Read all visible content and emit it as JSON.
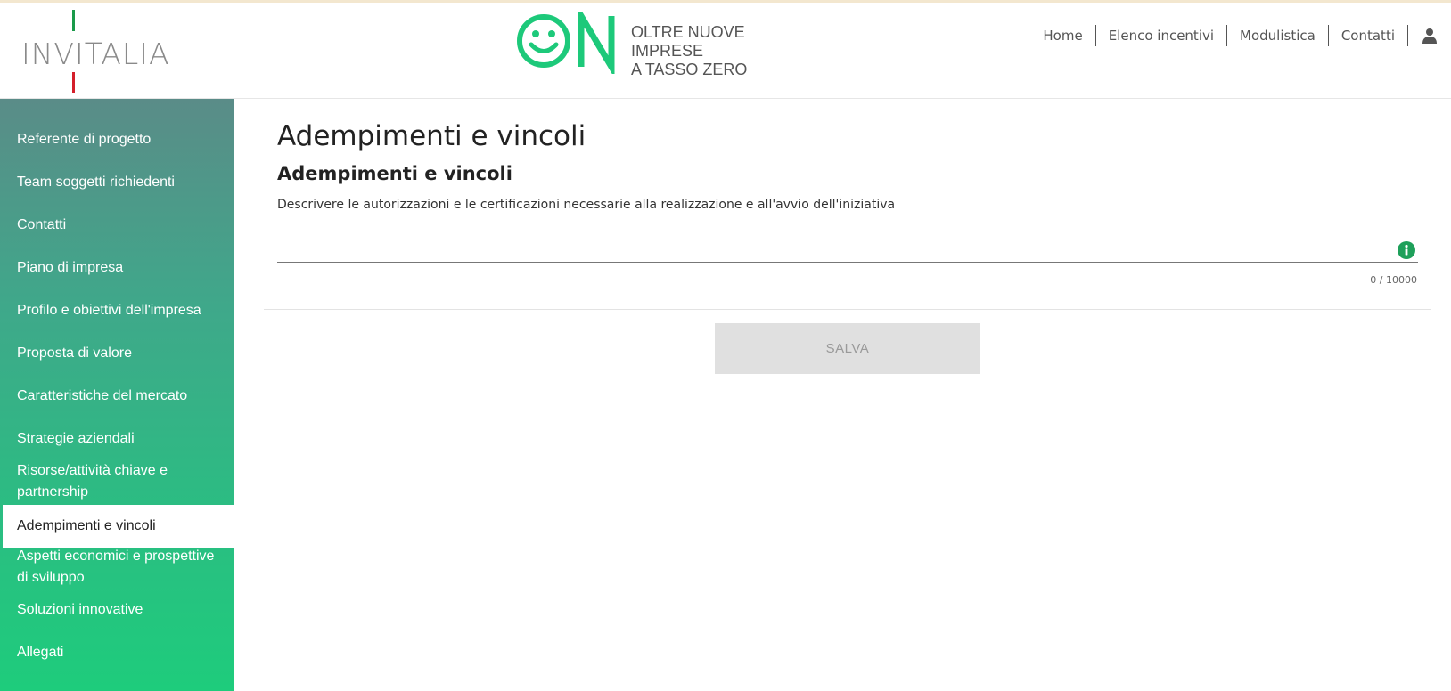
{
  "header": {
    "brand": "INVITALIA",
    "on_logo_tagline_1": "OLTRE NUOVE IMPRESE",
    "on_logo_tagline_2": "A TASSO ZERO",
    "nav": [
      {
        "label": "Home"
      },
      {
        "label": "Elenco incentivi"
      },
      {
        "label": "Modulistica"
      },
      {
        "label": "Contatti"
      }
    ],
    "user_icon": "user-icon"
  },
  "sidebar": {
    "items": [
      {
        "label": "Referente di progetto"
      },
      {
        "label": "Team soggetti richiedenti"
      },
      {
        "label": "Contatti"
      },
      {
        "label": "Piano di impresa"
      },
      {
        "label": "Profilo e obiettivi dell'impresa"
      },
      {
        "label": "Proposta di valore"
      },
      {
        "label": "Caratteristiche del mercato"
      },
      {
        "label": "Strategie aziendali"
      },
      {
        "label": "Risorse/attività chiave e partnership"
      },
      {
        "label": "Adempimenti e vincoli",
        "active": true
      },
      {
        "label": "Aspetti economici e prospettive di sviluppo"
      },
      {
        "label": "Soluzioni innovative"
      },
      {
        "label": "Allegati"
      }
    ]
  },
  "main": {
    "title": "Adempimenti e vincoli",
    "subtitle": "Adempimenti e vincoli",
    "description": "Descrivere le autorizzazioni e le certificazioni necessarie alla realizzazione e all'avvio dell'iniziativa",
    "field_value": "",
    "counter": "0 / 10000",
    "save_label": "SALVA"
  },
  "colors": {
    "accent_green": "#1ecc7c",
    "logo_green": "#1dc97a",
    "info_green": "#1ea05a",
    "sidebar_top": "#5a8c88"
  }
}
